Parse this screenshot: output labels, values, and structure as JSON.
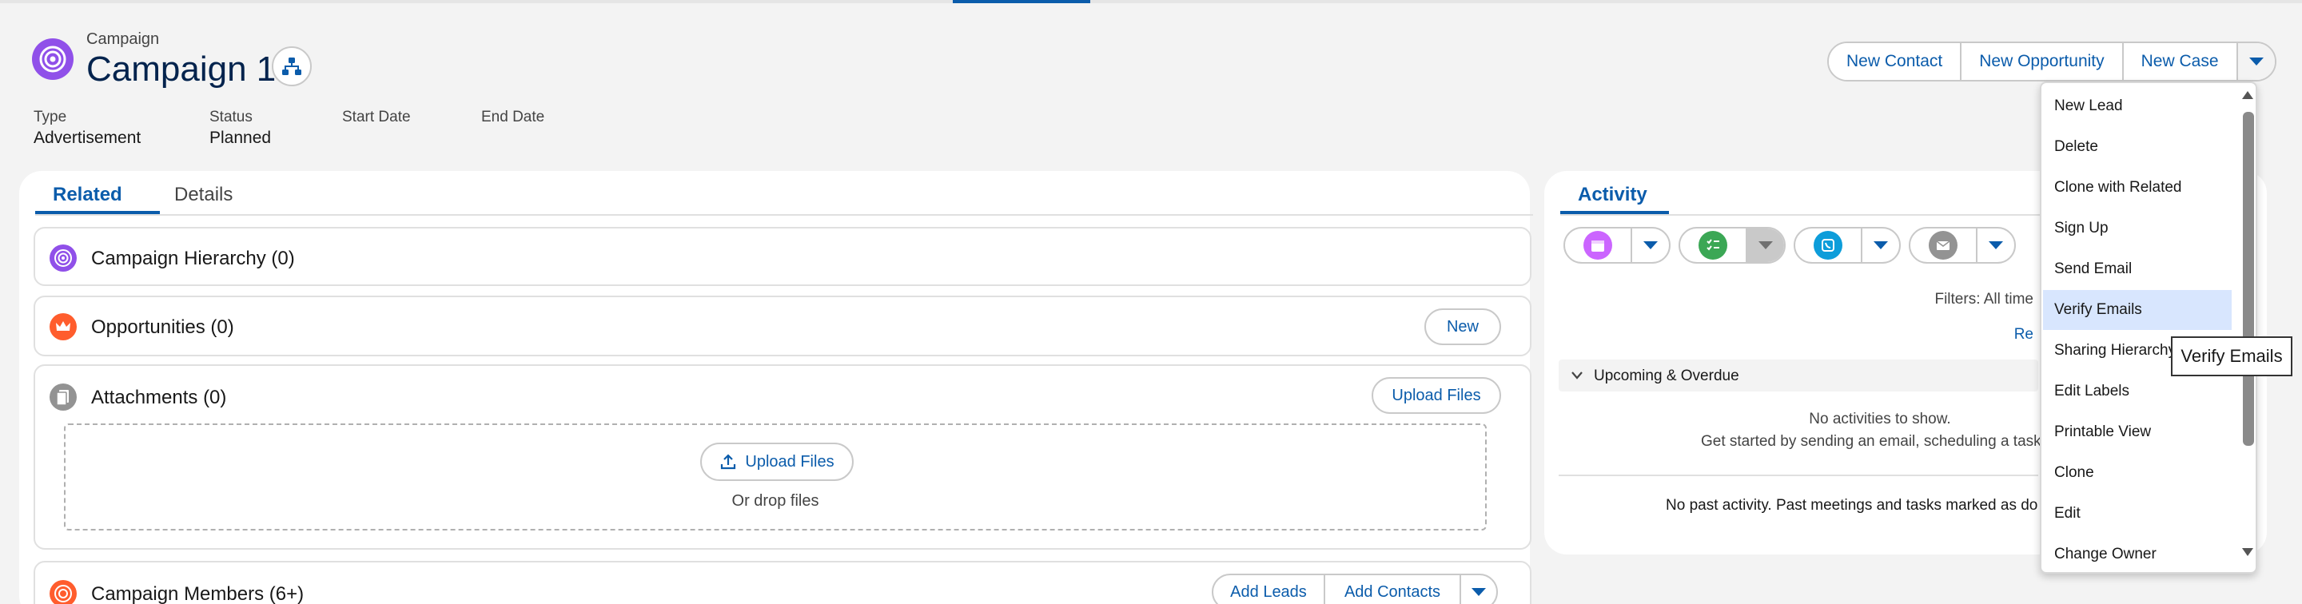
{
  "header": {
    "object_label": "Campaign",
    "record_title": "Campaign 1",
    "actions": {
      "new_contact": "New Contact",
      "new_opportunity": "New Opportunity",
      "new_case": "New Case"
    },
    "fields": [
      {
        "label": "Type",
        "value": "Advertisement"
      },
      {
        "label": "Status",
        "value": "Planned"
      },
      {
        "label": "Start Date",
        "value": ""
      },
      {
        "label": "End Date",
        "value": ""
      }
    ]
  },
  "tabs": {
    "related": "Related",
    "details": "Details"
  },
  "related": {
    "hierarchy": "Campaign Hierarchy (0)",
    "opportunities": "Opportunities (0)",
    "opportunities_new": "New",
    "attachments": "Attachments (0)",
    "upload_files": "Upload Files",
    "dropzone_button": "Upload Files",
    "drop_text": "Or drop files",
    "members": "Campaign Members (6+)",
    "add_leads": "Add Leads",
    "add_contacts": "Add Contacts"
  },
  "activity": {
    "tab": "Activity",
    "filters": "Filters: All time",
    "refresh": "Re",
    "upcoming": "Upcoming & Overdue",
    "no_activities": "No activities to show.",
    "get_started": "Get started by sending an email, scheduling a task",
    "no_past": "No past activity. Past meetings and tasks marked as do"
  },
  "menu": {
    "items": [
      "New Lead",
      "Delete",
      "Clone with Related",
      "Sign Up",
      "Send Email",
      "Verify Emails",
      "Sharing Hierarchy",
      "Edit Labels",
      "Printable View",
      "Clone",
      "Edit",
      "Change Owner"
    ],
    "highlighted": "Verify Emails"
  },
  "tooltip": "Verify Emails",
  "colors": {
    "accent": "#0b5cab",
    "campaign_icon": "#9050e9",
    "opportunity_icon": "#ff5d2d",
    "attachment_icon": "#939393",
    "event_icon": "#cb65ff",
    "task_icon": "#3ba755",
    "call_icon": "#0d9dda",
    "email_icon": "#939393"
  }
}
